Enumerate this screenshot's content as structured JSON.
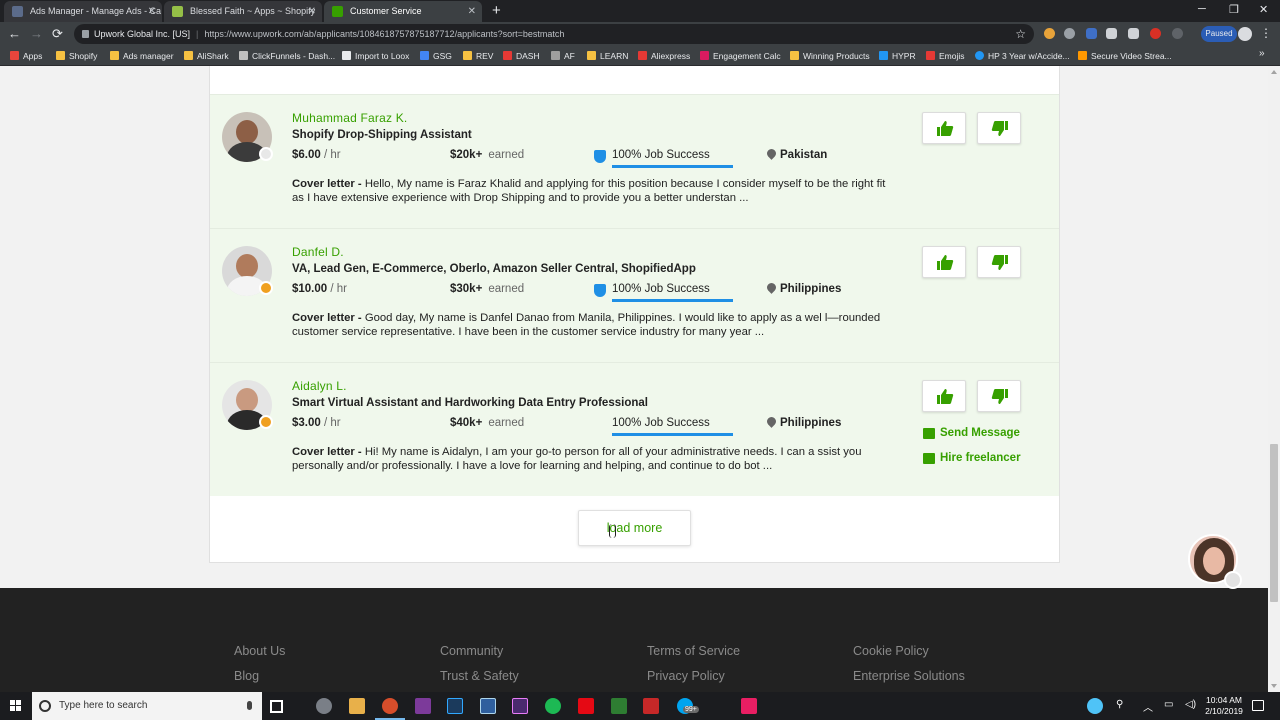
{
  "browser": {
    "tabs": [
      {
        "title": "Ads Manager - Manage Ads - Ca",
        "active": false,
        "icon_color": "#5b6b8a"
      },
      {
        "title": "Blessed Faith ~ Apps ~ Shopify",
        "active": false,
        "icon_color": "#95bf47"
      },
      {
        "title": "Customer Service",
        "active": true,
        "icon_color": "#37a000"
      }
    ],
    "new_tab_glyph": "+",
    "window_controls": {
      "minimize": "─",
      "restore": "❐",
      "close": "✕"
    },
    "nav": {
      "back": "←",
      "forward": "→",
      "reload": "⟳"
    },
    "address": {
      "site_identity": "Upwork Global Inc. [US]",
      "url": "https://www.upwork.com/ab/applicants/1084618757875187712/applicants?sort=bestmatch",
      "star": "☆"
    },
    "paused_label": "Paused",
    "menu_glyph": "⋮",
    "bookmarks": [
      {
        "label": "Apps",
        "color": "#e8453c"
      },
      {
        "label": "Shopify",
        "color": "#f6c142"
      },
      {
        "label": "Ads manager",
        "color": "#f6c142"
      },
      {
        "label": "AliShark",
        "color": "#f6c142"
      },
      {
        "label": "ClickFunnels - Dash...",
        "color": "#c0c0c0"
      },
      {
        "label": "Import to Loox",
        "color": "#e8eaed"
      },
      {
        "label": "GSG",
        "color": "#4285f4"
      },
      {
        "label": "REV",
        "color": "#f6c142"
      },
      {
        "label": "DASH",
        "color": "#e53935"
      },
      {
        "label": "AF",
        "color": "#9e9e9e"
      },
      {
        "label": "LEARN",
        "color": "#f6c142"
      },
      {
        "label": "Aliexpress",
        "color": "#e53935"
      },
      {
        "label": "Engagement Calc",
        "color": "#d81b60"
      },
      {
        "label": "Winning Products",
        "color": "#f6c142"
      },
      {
        "label": "HYPR",
        "color": "#2196f3"
      },
      {
        "label": "Emojis",
        "color": "#e53935"
      },
      {
        "label": "HP 3 Year w/Accide...",
        "color": "#2196f3"
      },
      {
        "label": "Secure Video Strea...",
        "color": "#ff9800"
      }
    ],
    "bookmarks_more": "»"
  },
  "applicants": [
    {
      "name": "Muhammad Faraz K.",
      "title": "Shopify Drop-Shipping Assistant",
      "rate": "$6.00",
      "rate_unit": "/ hr",
      "earned": "$20k+",
      "earned_label": "earned",
      "job_success": "100% Job Success",
      "location": "Pakistan",
      "cover_label": "Cover letter -",
      "cover_text": " Hello, My name is Faraz Khalid and applying for this position because I consider myself to be the right fit as I have extensive experience with Drop Shipping and to provide you a better understan ...",
      "status_color": "#e8e8e8",
      "skin": "#8d5f46",
      "shirt": "#3b3b3b",
      "show_badge": true
    },
    {
      "name": "Danfel D.",
      "title": "VA, Lead Gen, E-Commerce, Oberlo, Amazon Seller Central, ShopifiedApp",
      "rate": "$10.00",
      "rate_unit": "/ hr",
      "earned": "$30k+",
      "earned_label": "earned",
      "job_success": "100% Job Success",
      "location": "Philippines",
      "cover_label": "Cover letter -",
      "cover_text": " Good day, My name is Danfel Danao from Manila, Philippines. I would like to apply as a wel l—rounded customer service representative. I have been in the customer service industry for many year ...",
      "status_color": "#f0a020",
      "skin": "#b07b5c",
      "shirt": "#f4f4f4",
      "show_badge": true
    },
    {
      "name": "Aidalyn L.",
      "title": "Smart Virtual Assistant and Hardworking Data Entry Professional",
      "rate": "$3.00",
      "rate_unit": "/ hr",
      "earned": "$40k+",
      "earned_label": "earned",
      "job_success": "100% Job Success",
      "location": "Philippines",
      "cover_label": "Cover letter -",
      "cover_text": " Hi! My name is Aidalyn, I am your go-to person for all of your administrative needs. I can a ssist you personally and/or professionally. I have a love for learning and helping, and continue to do bot ...",
      "status_color": "#f0a020",
      "skin": "#c99a80",
      "shirt": "#2a2a2a",
      "show_badge": false,
      "send_message": "Send Message",
      "hire": "Hire freelancer"
    }
  ],
  "load_more": "load more",
  "footer": {
    "col1": [
      "About Us",
      "Blog"
    ],
    "col2": [
      "Community",
      "Trust & Safety"
    ],
    "col3": [
      "Terms of Service",
      "Privacy Policy"
    ],
    "col4": [
      "Cookie Policy",
      "Enterprise Solutions"
    ]
  },
  "taskbar": {
    "search_placeholder": "Type here to search",
    "badge": "99+",
    "time": "10:04 AM",
    "date": "2/10/2019",
    "apps": [
      "#7a7f87",
      "#e8b04a",
      "#d64d2b",
      "#7c3a9a",
      "#1b3a5c",
      "#2f5f9e",
      "#4a2a6e",
      "#1db954",
      "#e50914",
      "#2e7d32",
      "#c62828",
      "#00a4ef",
      "#e91e63"
    ]
  },
  "colors": {
    "upwork_green": "#37a000",
    "applicant_bg": "#f0f8ec",
    "jss_blue": "#1f8fe5",
    "footer_bg": "#222222"
  }
}
